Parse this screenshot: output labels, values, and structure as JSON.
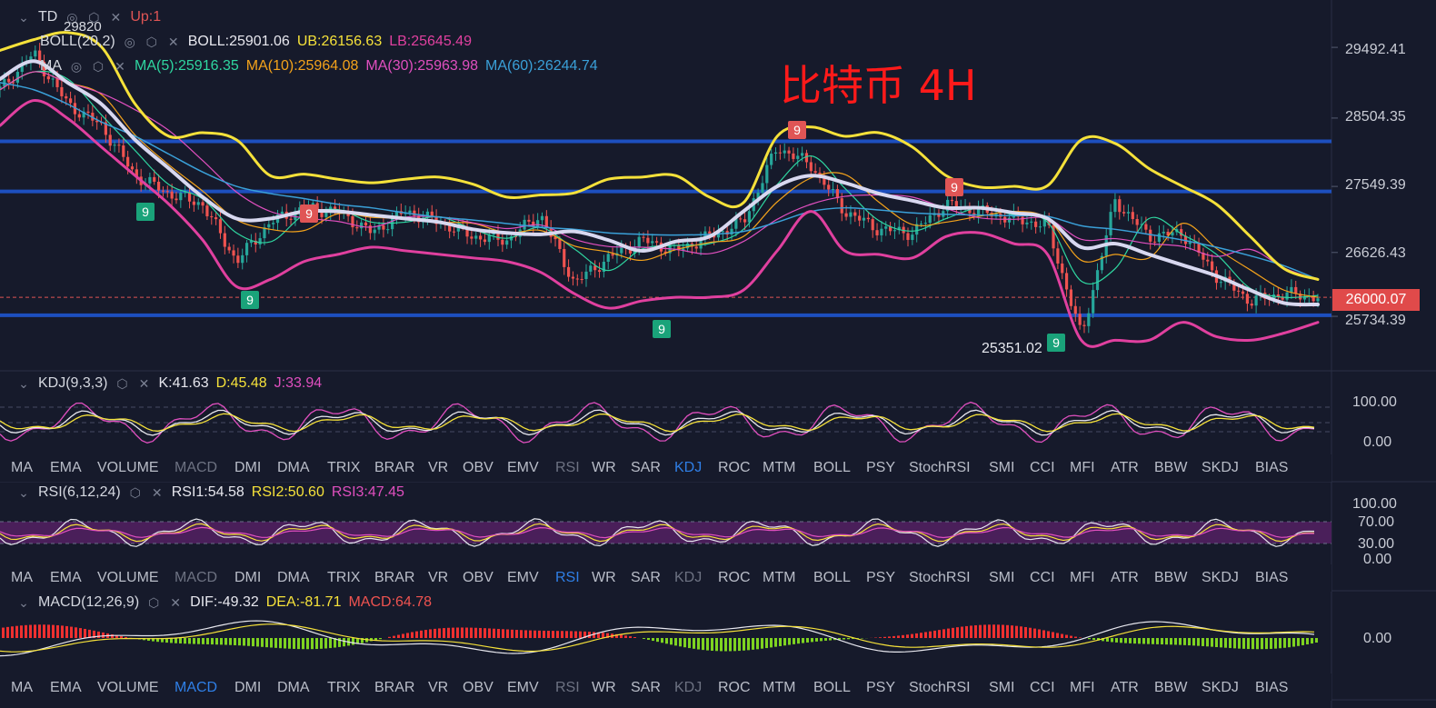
{
  "title": "比特币 4H",
  "main": {
    "td": {
      "label": "TD",
      "up": "Up:1",
      "mark": "29820"
    },
    "boll": {
      "label": "BOLL(20,2)",
      "mid": "BOLL:25901.06",
      "ub": "UB:26156.63",
      "lb": "LB:25645.49"
    },
    "ma": {
      "label": "MA",
      "ma5": "MA(5):25916.35",
      "ma10": "MA(10):25964.08",
      "ma30": "MA(30):25963.98",
      "ma60": "MA(60):26244.74"
    },
    "price_axis": [
      "29492.41",
      "28504.35",
      "27549.39",
      "26626.43",
      "25734.39"
    ],
    "current_price": "26000.07",
    "low_label": "25351.02",
    "td_marks": [
      "9",
      "9",
      "9",
      "9",
      "9",
      "9",
      "9"
    ]
  },
  "kdj": {
    "label": "KDJ(9,3,3)",
    "k": "K:41.63",
    "d": "D:45.48",
    "j": "J:33.94",
    "axis": [
      "100.00",
      "0.00"
    ]
  },
  "rsi": {
    "label": "RSI(6,12,24)",
    "r1": "RSI1:54.58",
    "r2": "RSI2:50.60",
    "r3": "RSI3:47.45",
    "axis": [
      "100.00",
      "70.00",
      "30.00",
      "0.00"
    ]
  },
  "macd": {
    "label": "MACD(12,26,9)",
    "dif": "DIF:-49.32",
    "dea": "DEA:-81.71",
    "macd": "MACD:64.78",
    "axis": [
      "0.00"
    ]
  },
  "indicator_tabs": [
    "MA",
    "EMA",
    "VOLUME",
    "MACD",
    "DMI",
    "DMA",
    "TRIX",
    "BRAR",
    "VR",
    "OBV",
    "EMV",
    "RSI",
    "WR",
    "SAR",
    "KDJ",
    "ROC",
    "MTM",
    "BOLL",
    "PSY",
    "StochRSI",
    "SMI",
    "CCI",
    "MFI",
    "ATR",
    "BBW",
    "SKDJ",
    "BIAS"
  ],
  "colors": {
    "bg": "#161a2b",
    "up": "#26a69a",
    "down": "#ef5350",
    "boll": "#f5e13a",
    "ma_white": "#d8d8f0",
    "lb": "#e0409f",
    "ma60": "#3aa0d8",
    "level": "#1d4fbf",
    "title": "#ff1a1a"
  },
  "chart_data": {
    "type": "line",
    "title": "比特币 4H",
    "ylim": [
      25100,
      29900
    ],
    "yticks": [
      29492.41,
      28504.35,
      27549.39,
      26626.43,
      25734.39
    ],
    "current_price": 26000.07,
    "horizontal_levels": [
      28180,
      27480,
      25750
    ],
    "series": [
      {
        "name": "BOLL UB",
        "values": [
          29450,
          29600,
          29700,
          29500,
          28700,
          28250,
          28300,
          28200,
          27700,
          27720,
          27650,
          27600,
          27650,
          27680,
          27580,
          27400,
          27430,
          27460,
          27650,
          27680,
          27700,
          27400,
          27320,
          28250,
          28380,
          28250,
          28300,
          28100,
          27700,
          27540,
          27550,
          27560,
          28200,
          28150,
          27800,
          27550,
          27300,
          26850,
          26400,
          26250
        ]
      },
      {
        "name": "BOLL",
        "values": [
          29050,
          29300,
          29000,
          28700,
          28200,
          27800,
          27400,
          27100,
          27100,
          27200,
          27200,
          27150,
          27100,
          27050,
          26950,
          26900,
          26880,
          26920,
          26800,
          26650,
          26780,
          26850,
          27200,
          27550,
          27700,
          27600,
          27450,
          27350,
          27250,
          27250,
          27180,
          27100,
          26700,
          26750,
          26600,
          26450,
          26300,
          26100,
          25920,
          25900
        ]
      },
      {
        "name": "BOLL LB",
        "values": [
          28400,
          28750,
          28500,
          28100,
          27700,
          27300,
          26800,
          26150,
          26250,
          26500,
          26600,
          26700,
          26650,
          26600,
          26550,
          26500,
          26350,
          26050,
          25850,
          25950,
          26000,
          26000,
          26100,
          26650,
          27200,
          26650,
          26600,
          26550,
          26850,
          26900,
          26750,
          26600,
          25400,
          25400,
          25400,
          25650,
          25450,
          25400,
          25500,
          25650
        ]
      },
      {
        "name": "MA(60)",
        "values": [
          29000,
          28900,
          28700,
          28450,
          28250,
          28000,
          27750,
          27550,
          27450,
          27380,
          27300,
          27250,
          27180,
          27120,
          27080,
          27030,
          26980,
          26950,
          26900,
          26880,
          26870,
          26880,
          26920,
          27050,
          27200,
          27250,
          27220,
          27180,
          27160,
          27150,
          27140,
          27130,
          27000,
          26950,
          26880,
          26800,
          26700,
          26580,
          26440,
          26250
        ]
      },
      {
        "name": "Price",
        "values": [
          28900,
          29400,
          28700,
          28400,
          27700,
          27450,
          27300,
          26500,
          27050,
          27250,
          27200,
          26900,
          27200,
          27050,
          26850,
          26800,
          27150,
          26200,
          26550,
          26800,
          26650,
          26850,
          27050,
          28100,
          27850,
          27200,
          26950,
          26900,
          27300,
          27200,
          27100,
          27000,
          25450,
          27350,
          26850,
          26900,
          26300,
          25950,
          26050,
          26000
        ]
      }
    ]
  }
}
